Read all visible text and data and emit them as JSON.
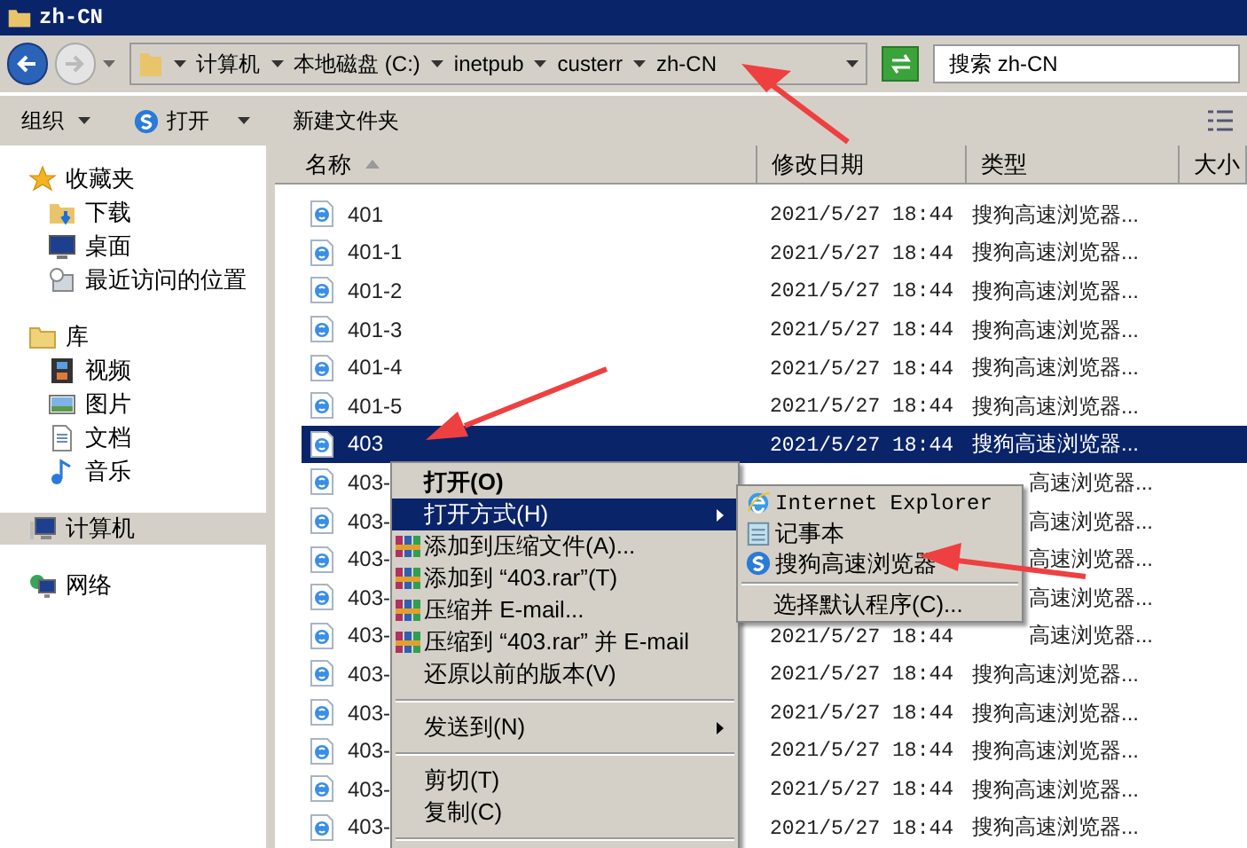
{
  "window": {
    "title": "zh-CN"
  },
  "address_bar": {
    "segments": [
      "计算机",
      "本地磁盘 (C:)",
      "inetpub",
      "custerr",
      "zh-CN"
    ]
  },
  "search": {
    "placeholder": "搜索 zh-CN"
  },
  "toolbar": [
    "组织",
    "打开",
    "新建文件夹"
  ],
  "sidebar": {
    "groups": [
      {
        "label": "收藏夹",
        "selected": false,
        "children": [
          {
            "label": "下载",
            "selected": false
          },
          {
            "label": "桌面",
            "selected": false
          },
          {
            "label": "最近访问的位置",
            "selected": false
          }
        ]
      },
      {
        "label": "库",
        "selected": false,
        "children": [
          {
            "label": "视频",
            "selected": false
          },
          {
            "label": "图片",
            "selected": false
          },
          {
            "label": "文档",
            "selected": false
          },
          {
            "label": "音乐",
            "selected": false
          }
        ]
      },
      {
        "label": "计算机",
        "selected": true
      },
      {
        "label": "网络",
        "selected": false
      }
    ]
  },
  "table": {
    "columns": [
      "名称",
      "修改日期",
      "类型",
      "大小"
    ],
    "rows": [
      {
        "kind": "row",
        "name": "401",
        "date": "2021/5/27 18:44",
        "type": "搜狗高速浏览器...",
        "selected": false
      },
      {
        "kind": "row",
        "name": "401-1",
        "date": "2021/5/27 18:44",
        "type": "搜狗高速浏览器...",
        "selected": false
      },
      {
        "kind": "row",
        "name": "401-2",
        "date": "2021/5/27 18:44",
        "type": "搜狗高速浏览器...",
        "selected": false
      },
      {
        "kind": "row",
        "name": "401-3",
        "date": "2021/5/27 18:44",
        "type": "搜狗高速浏览器...",
        "selected": false
      },
      {
        "kind": "row",
        "name": "401-4",
        "date": "2021/5/27 18:44",
        "type": "搜狗高速浏览器...",
        "selected": false
      },
      {
        "kind": "row",
        "name": "401-5",
        "date": "2021/5/27 18:44",
        "type": "搜狗高速浏览器...",
        "selected": false
      },
      {
        "kind": "row",
        "name": "403",
        "date": "2021/5/27 18:44",
        "type": "搜狗高速浏览器...",
        "selected": true
      },
      {
        "kind": "covered",
        "name": "403-",
        "type": "高速浏览器...",
        "selected": false
      },
      {
        "kind": "covered",
        "name": "403-",
        "type": "高速浏览器...",
        "selected": false
      },
      {
        "kind": "covered",
        "name": "403-",
        "type": "高速浏览器...",
        "selected": false
      },
      {
        "kind": "covered",
        "name": "403-",
        "type": "高速浏览器...",
        "selected": false
      },
      {
        "kind": "covered",
        "name": "403-",
        "date": "2021/5/27 18:44",
        "type": "高速浏览器...",
        "selected": false
      },
      {
        "kind": "row",
        "name": "403-",
        "date": "2021/5/27 18:44",
        "type": "搜狗高速浏览器...",
        "selected": false
      },
      {
        "kind": "row",
        "name": "403-",
        "date": "2021/5/27 18:44",
        "type": "搜狗高速浏览器...",
        "selected": false
      },
      {
        "kind": "row",
        "name": "403-",
        "date": "2021/5/27 18:44",
        "type": "搜狗高速浏览器...",
        "selected": false
      },
      {
        "kind": "row",
        "name": "403-",
        "date": "2021/5/27 18:44",
        "type": "搜狗高速浏览器...",
        "selected": false
      },
      {
        "kind": "row",
        "name": "403-",
        "date": "2021/5/27 18:44",
        "type": "搜狗高速浏览器...",
        "selected": false
      }
    ]
  },
  "context_menu": {
    "items": [
      {
        "kind": "item",
        "label": "打开(O)",
        "bold": true,
        "selected": false
      },
      {
        "kind": "submenu",
        "label": "打开方式(H)",
        "bold": false,
        "selected": true
      },
      {
        "kind": "rar",
        "label": "添加到压缩文件(A)...",
        "bold": false,
        "selected": false
      },
      {
        "kind": "rar",
        "label": "添加到 “403.rar”(T)",
        "bold": false,
        "selected": false
      },
      {
        "kind": "rar",
        "label": "压缩并 E-mail...",
        "bold": false,
        "selected": false
      },
      {
        "kind": "rar",
        "label": "压缩到 “403.rar” 并 E-mail",
        "bold": false,
        "selected": false
      },
      {
        "kind": "item",
        "label": "还原以前的版本(V)",
        "bold": false,
        "selected": false
      },
      {
        "kind": "separator"
      },
      {
        "kind": "submenu",
        "label": "发送到(N)",
        "bold": false,
        "selected": false
      },
      {
        "kind": "separator"
      },
      {
        "kind": "item",
        "label": "剪切(T)",
        "bold": false,
        "selected": false
      },
      {
        "kind": "item",
        "label": "复制(C)",
        "bold": false,
        "selected": false
      },
      {
        "kind": "separator"
      }
    ]
  },
  "submenu": {
    "items": [
      {
        "kind": "ie",
        "label": "Internet Explorer"
      },
      {
        "kind": "notepad",
        "label": "记事本"
      },
      {
        "kind": "sogou",
        "label": "搜狗高速浏览器"
      },
      {
        "kind": "separator"
      },
      {
        "kind": "item",
        "label": "选择默认程序(C)..."
      }
    ]
  }
}
